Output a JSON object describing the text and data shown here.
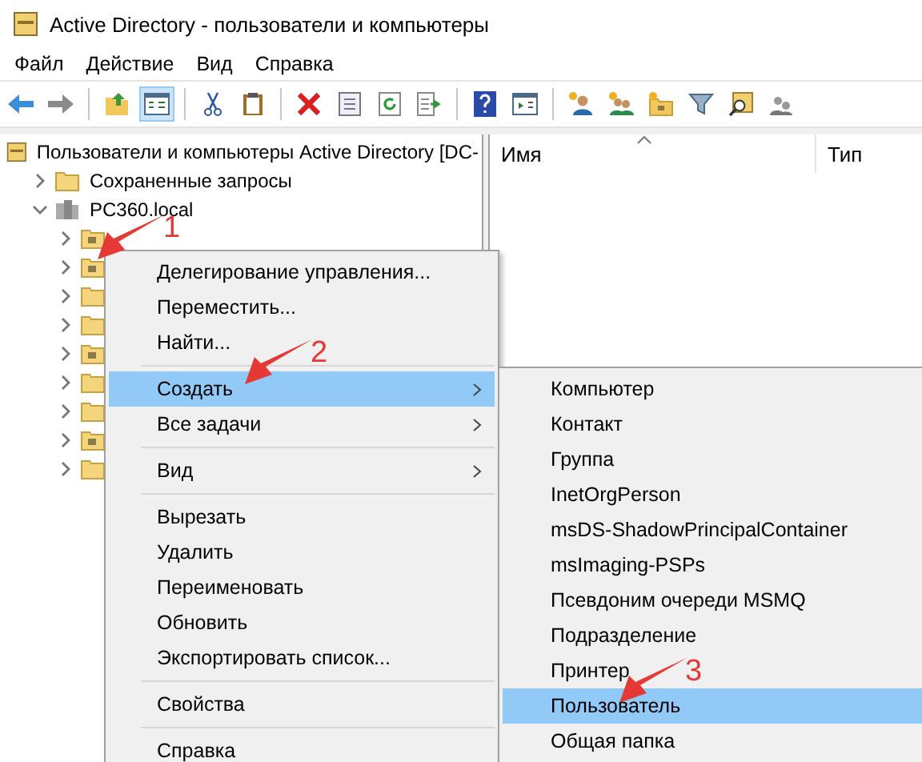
{
  "window": {
    "title": "Active Directory - пользователи и компьютеры"
  },
  "menu_bar": [
    "Файл",
    "Действие",
    "Вид",
    "Справка"
  ],
  "toolbar": [
    {
      "kind": "back"
    },
    {
      "kind": "forward"
    },
    {
      "kind": "sep"
    },
    {
      "kind": "up",
      "pressed": false
    },
    {
      "kind": "tree",
      "pressed": true
    },
    {
      "kind": "sep"
    },
    {
      "kind": "cut"
    },
    {
      "kind": "paste"
    },
    {
      "kind": "sep"
    },
    {
      "kind": "delete"
    },
    {
      "kind": "props"
    },
    {
      "kind": "refresh"
    },
    {
      "kind": "export"
    },
    {
      "kind": "sep"
    },
    {
      "kind": "help"
    },
    {
      "kind": "pane"
    },
    {
      "kind": "sep"
    },
    {
      "kind": "user"
    },
    {
      "kind": "group"
    },
    {
      "kind": "ou"
    },
    {
      "kind": "filter"
    },
    {
      "kind": "find"
    },
    {
      "kind": "addgroup"
    }
  ],
  "tree": {
    "label": "Пользователи и компьютеры Active Directory [DC-",
    "children": [
      {
        "label": "Сохраненные запросы",
        "kind": "folder",
        "expanded": false
      },
      {
        "label": "PC360.local",
        "kind": "domain",
        "expanded": true,
        "children": [
          {
            "kind": "ou"
          },
          {
            "kind": "ou"
          },
          {
            "kind": "folder"
          },
          {
            "kind": "folder"
          },
          {
            "kind": "ou"
          },
          {
            "kind": "folder"
          },
          {
            "kind": "folder"
          },
          {
            "kind": "ou"
          },
          {
            "kind": "folder"
          }
        ]
      }
    ]
  },
  "list_columns": [
    {
      "label": "Имя",
      "sorted": true
    },
    {
      "label": "Тип"
    }
  ],
  "context_menu": [
    {
      "kind": "item",
      "label": "Делегирование управления...",
      "selected": false,
      "submenu": false
    },
    {
      "kind": "item",
      "label": "Переместить...",
      "selected": false,
      "submenu": false
    },
    {
      "kind": "item",
      "label": "Найти...",
      "selected": false,
      "submenu": false
    },
    {
      "kind": "separator"
    },
    {
      "kind": "item",
      "label": "Создать",
      "selected": true,
      "submenu": true
    },
    {
      "kind": "item",
      "label": "Все задачи",
      "selected": false,
      "submenu": true
    },
    {
      "kind": "separator"
    },
    {
      "kind": "item",
      "label": "Вид",
      "selected": false,
      "submenu": true
    },
    {
      "kind": "separator"
    },
    {
      "kind": "item",
      "label": "Вырезать",
      "selected": false,
      "submenu": false
    },
    {
      "kind": "item",
      "label": "Удалить",
      "selected": false,
      "submenu": false
    },
    {
      "kind": "item",
      "label": "Переименовать",
      "selected": false,
      "submenu": false
    },
    {
      "kind": "item",
      "label": "Обновить",
      "selected": false,
      "submenu": false
    },
    {
      "kind": "item",
      "label": "Экспортировать список...",
      "selected": false,
      "submenu": false
    },
    {
      "kind": "separator"
    },
    {
      "kind": "item",
      "label": "Свойства",
      "selected": false,
      "submenu": false
    },
    {
      "kind": "separator"
    },
    {
      "kind": "item",
      "label": "Справка",
      "selected": false,
      "submenu": false
    }
  ],
  "submenu": [
    {
      "label": "Компьютер",
      "selected": false
    },
    {
      "label": "Контакт",
      "selected": false
    },
    {
      "label": "Группа",
      "selected": false
    },
    {
      "label": "InetOrgPerson",
      "selected": false
    },
    {
      "label": "msDS-ShadowPrincipalContainer",
      "selected": false
    },
    {
      "label": "msImaging-PSPs",
      "selected": false
    },
    {
      "label": "Псевдоним очереди MSMQ",
      "selected": false
    },
    {
      "label": "Подразделение",
      "selected": false
    },
    {
      "label": "Принтер",
      "selected": false
    },
    {
      "label": "Пользователь",
      "selected": true
    },
    {
      "label": "Общая папка",
      "selected": false
    }
  ],
  "annotations": [
    {
      "label": "1"
    },
    {
      "label": "2"
    },
    {
      "label": "3"
    }
  ]
}
